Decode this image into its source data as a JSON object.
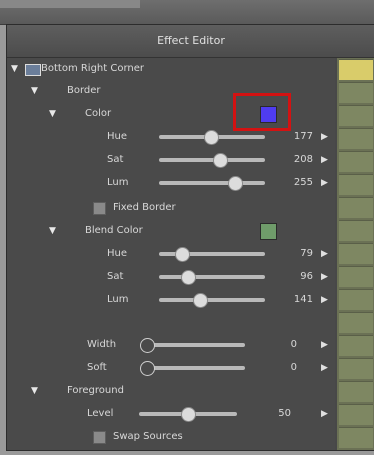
{
  "window": {
    "title": "Effect Editor"
  },
  "tree": {
    "root_label": "Bottom Right Corner",
    "border_label": "Border",
    "color_label": "Color",
    "color_swatch": "#4f3cf0",
    "color_params": [
      {
        "label": "Hue",
        "value": "177",
        "fraction": 0.49
      },
      {
        "label": "Sat",
        "value": "208",
        "fraction": 0.58
      },
      {
        "label": "Lum",
        "value": "255",
        "fraction": 0.72
      }
    ],
    "fixed_border_label": "Fixed Border",
    "blend_color_label": "Blend Color",
    "blend_swatch": "#6f9c6a",
    "blend_params": [
      {
        "label": "Hue",
        "value": "79",
        "fraction": 0.22
      },
      {
        "label": "Sat",
        "value": "96",
        "fraction": 0.27
      },
      {
        "label": "Lum",
        "value": "141",
        "fraction": 0.39
      }
    ],
    "width": {
      "label": "Width",
      "value": "0",
      "fraction": 0.0
    },
    "soft": {
      "label": "Soft",
      "value": "0",
      "fraction": 0.0
    },
    "foreground_label": "Foreground",
    "level": {
      "label": "Level",
      "value": "50",
      "fraction": 0.5
    },
    "swap_sources_label": "Swap Sources"
  },
  "colors": {
    "highlight": "#d31212",
    "keyframe_first": "#d9cc6a",
    "keyframe": "#7e8762"
  }
}
